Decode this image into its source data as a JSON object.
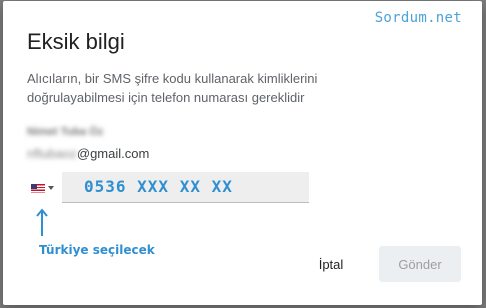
{
  "watermark": "Sordum.net",
  "dialog": {
    "title": "Eksik bilgi",
    "description": "Alıcıların, bir SMS şifre kodu kullanarak kimliklerini doğrulayabilmesi için telefon numarası gereklidir",
    "account_name": "Nimet Tuba Öz",
    "email_local": "nftubaoz",
    "email_domain": "@gmail.com",
    "country_flag": "us-flag-icon",
    "phone_value": "0536 XXX XX XX",
    "hint": "Türkiye seçilecek",
    "cancel_label": "İptal",
    "send_label": "Gönder"
  },
  "colors": {
    "annotation": "#2f8fd0",
    "watermark": "#4da3d9",
    "send_disabled_bg": "#eceff1",
    "send_disabled_text": "#9e9e9e"
  }
}
